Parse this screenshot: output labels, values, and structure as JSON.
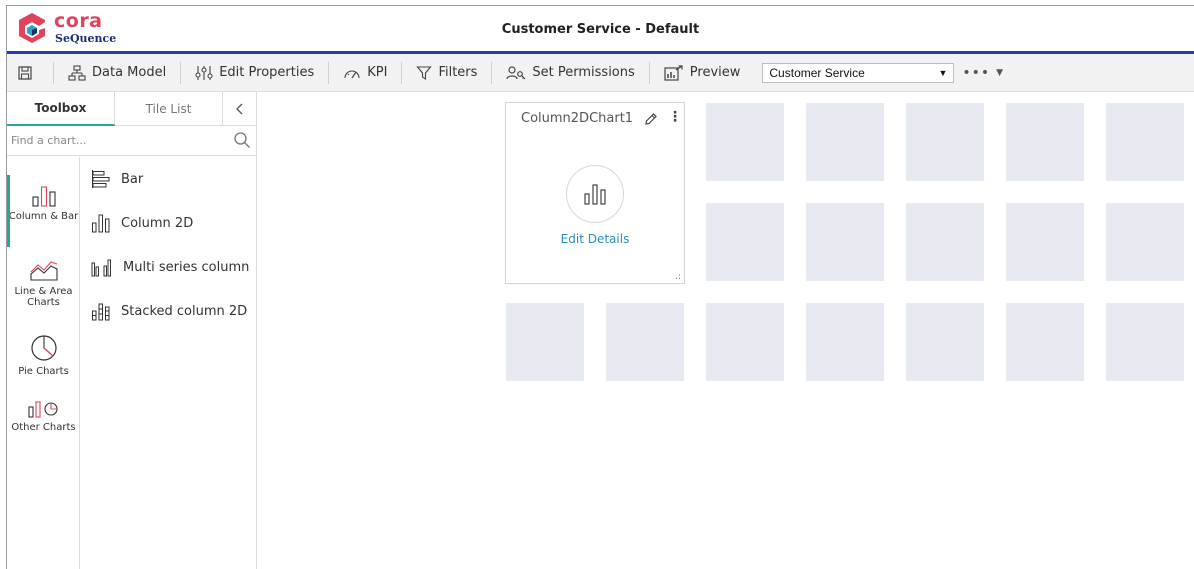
{
  "app": {
    "logo_word": "cora",
    "logo_sub": "SeQuence",
    "title": "Customer Service - Default",
    "colors": {
      "brand_blue": "#2b3bb5",
      "brand_pink": "#e0435a",
      "accent_teal": "#2aa39a",
      "link": "#2a8fc0",
      "tile": "#e7ebf1"
    }
  },
  "toolbar": {
    "save_icon": "save-icon",
    "data_model": "Data Model",
    "edit_properties": "Edit Properties",
    "kpi": "KPI",
    "filters": "Filters",
    "set_permissions": "Set Permissions",
    "preview": "Preview",
    "selected_service": "Customer Service",
    "more": "•••"
  },
  "panel": {
    "tabs": {
      "toolbox": "Toolbox",
      "tile_list": "Tile List",
      "collapse": "<"
    },
    "search_placeholder": "Find a chart...",
    "categories": [
      {
        "label": "Column & Bar",
        "icon": "column-bar-icon",
        "active": true
      },
      {
        "label": "Line & Area Charts",
        "icon": "line-area-icon",
        "active": false
      },
      {
        "label": "Pie Charts",
        "icon": "pie-chart-icon",
        "active": false
      },
      {
        "label": "Other Charts",
        "icon": "other-charts-icon",
        "active": false
      }
    ],
    "charts": [
      {
        "label": "Bar",
        "icon": "bar-chart-icon"
      },
      {
        "label": "Column 2D",
        "icon": "column-2d-icon"
      },
      {
        "label": "Multi series column",
        "icon": "multi-series-column-icon"
      },
      {
        "label": "Stacked column 2D",
        "icon": "stacked-column-icon"
      }
    ]
  },
  "card": {
    "title": "Column2DChart1",
    "link": "Edit Details",
    "menu": "⋮",
    "grip": ".:"
  }
}
